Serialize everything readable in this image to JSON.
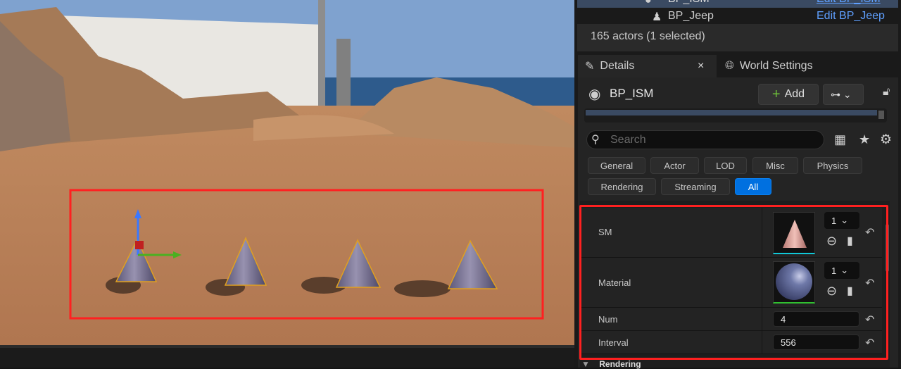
{
  "outliner": {
    "rows": [
      {
        "name": "BP_ISM",
        "action": "Edit BP_ISM",
        "selected": true
      },
      {
        "name": "BP_Jeep",
        "action": "Edit BP_Jeep",
        "selected": false
      }
    ],
    "status": "165 actors (1 selected)"
  },
  "tabs": [
    {
      "label": "Details",
      "close": "×",
      "active": true
    },
    {
      "label": "World Settings",
      "active": false
    }
  ],
  "details": {
    "actor_name": "BP_ISM",
    "add_label": "Add",
    "search_placeholder": "Search",
    "filters": [
      "General",
      "Actor",
      "LOD",
      "Misc",
      "Physics",
      "Rendering",
      "Streaming",
      "All"
    ],
    "active_filter": "All",
    "properties": [
      {
        "label": "SM",
        "count": "1"
      },
      {
        "label": "Material",
        "count": "1"
      },
      {
        "label": "Num",
        "value": "4"
      },
      {
        "label": "Interval",
        "value": "556"
      }
    ],
    "next_section": "Rendering"
  },
  "colors": {
    "accent": "#0070e0",
    "highlight": "#ff2020",
    "selected_row": "#3a4a62"
  }
}
